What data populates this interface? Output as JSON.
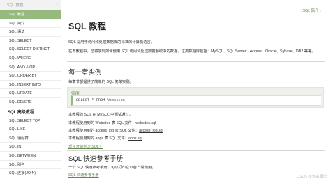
{
  "sidebar": {
    "header": "SQL 教程",
    "items": [
      {
        "label": "SQL 教程",
        "active": true
      },
      {
        "label": "SQL 简介"
      },
      {
        "label": "SQL 语法"
      },
      {
        "label": "SQL SELECT"
      },
      {
        "label": "SQL SELECT DISTINCT"
      },
      {
        "label": "SQL WHERE"
      },
      {
        "label": "SQL AND & OR"
      },
      {
        "label": "SQL ORDER BY"
      },
      {
        "label": "SQL INSERT INTO"
      },
      {
        "label": "SQL UPDATE"
      },
      {
        "label": "SQL DELETE"
      }
    ],
    "section_title": "SQL 高级教程",
    "advanced_items": [
      {
        "label": "SQL SELECT TOP"
      },
      {
        "label": "SQL LIKE"
      },
      {
        "label": "SQL 通配符"
      },
      {
        "label": "SQL IN"
      },
      {
        "label": "SQL BETWEEN"
      },
      {
        "label": "SQL 别名"
      },
      {
        "label": "SQL 连接(JOIN)"
      }
    ]
  },
  "main": {
    "next_link": "SQL 简介 ›",
    "title": "SQL 教程",
    "intro1": "SQL 是用于访问和处理数据库的标准的计算机语言。",
    "intro2": "在本教程中，您将学到如何使用 SQL 访问和处理数据系统中的数据，这类数据库包括：MySQL、SQL Server、Access、Oracle、Sybase、DB2 等等。",
    "section1_title": "每一章实例",
    "section1_text": "每章节都提供了简单的 SQL 简单实例。",
    "example_label": "实例",
    "example_code": "SELECT * FROM Websites;",
    "db_note": "本教程的 SQL 在 MySQL 中测试通过。",
    "files": [
      {
        "text": "本教程使用到的 Websites 表 SQL 文件：",
        "link": "websites.sql"
      },
      {
        "text": "本教程使用到的 access_log 表 SQL 文件：",
        "link": "access_log.sql"
      },
      {
        "text": "本教程使用到的 apps 表 SQL 文件：",
        "link": "apps.sql"
      }
    ],
    "start_link": "现在开始学习 SQL！",
    "section2_title": "SQL 快速参考手册",
    "section2_text": "一个 SQL 快速参考手册，可以打印它以备日常使用。",
    "quickref_link": "SQL 快速参考手册"
  },
  "watermark": "CSDN @九章算法"
}
